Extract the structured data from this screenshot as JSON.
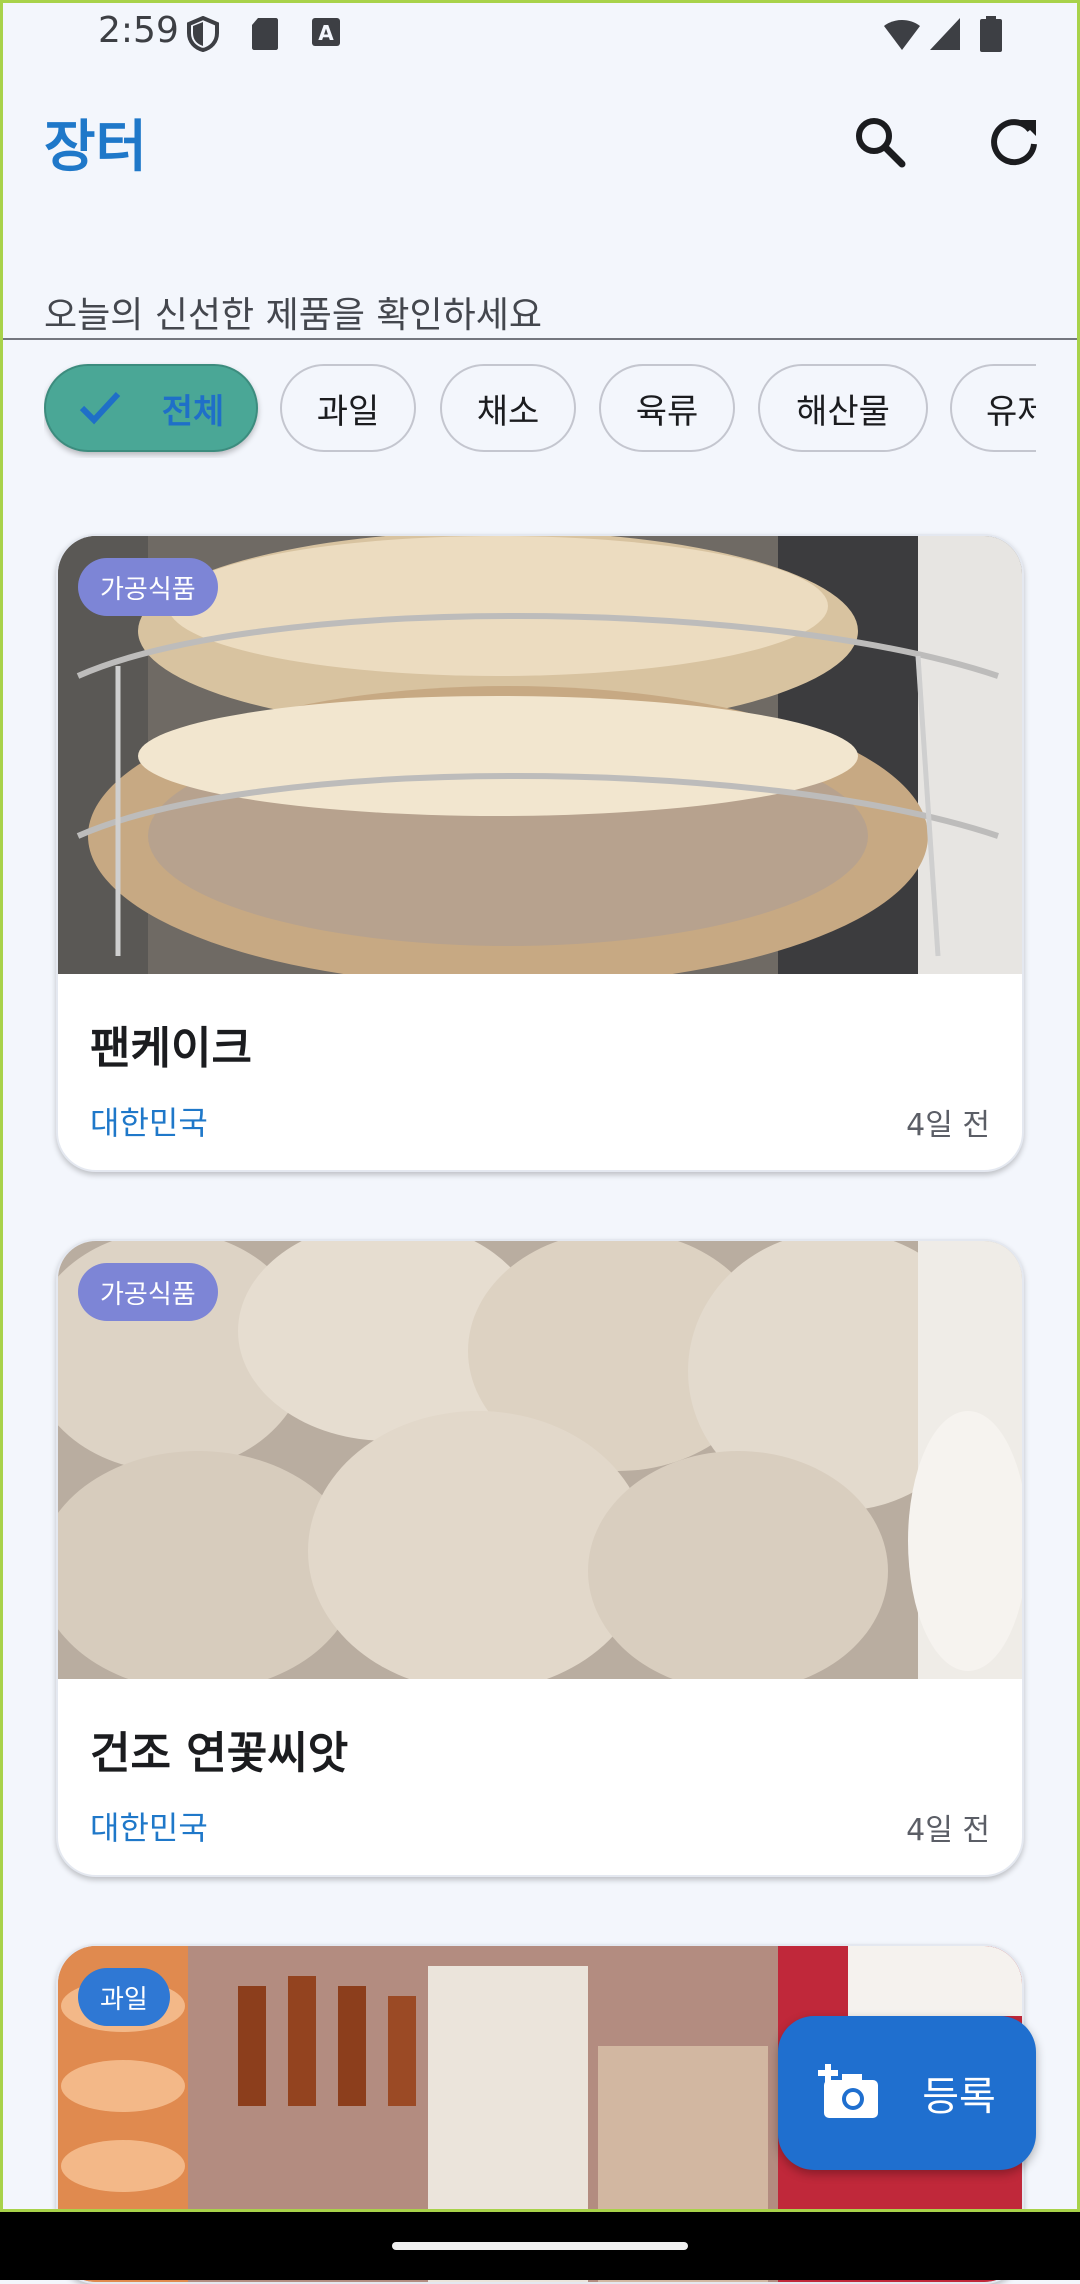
{
  "status_bar": {
    "time": "2:59"
  },
  "app_bar": {
    "title": "장터",
    "subtitle": "오늘의 신선한 제품을 확인하세요"
  },
  "chips": [
    {
      "label": "전체",
      "selected": true
    },
    {
      "label": "과일",
      "selected": false
    },
    {
      "label": "채소",
      "selected": false
    },
    {
      "label": "육류",
      "selected": false
    },
    {
      "label": "해산물",
      "selected": false
    },
    {
      "label": "유제품",
      "selected": false
    }
  ],
  "cards": [
    {
      "badge": "가공식품",
      "title": "팬케이크",
      "origin": "대한민국",
      "date": "4일 전"
    },
    {
      "badge": "가공식품",
      "title": "건조 연꽃씨앗",
      "origin": "대한민국",
      "date": "4일 전"
    },
    {
      "badge": "과일"
    }
  ],
  "fab": {
    "label": "등록"
  },
  "colors": {
    "accent": "#1f78c9",
    "chip_selected": "#4aa796",
    "badge": "#7d85d6",
    "fab": "#1f6fcf"
  }
}
